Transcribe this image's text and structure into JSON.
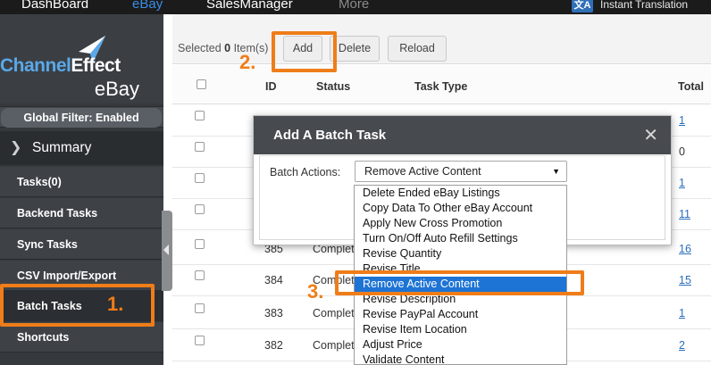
{
  "topnav": {
    "items": [
      "DashBoard",
      "eBay",
      "SalesManager",
      "More"
    ],
    "translate_label": "Instant Translation",
    "translate_icon": "translate-icon"
  },
  "sidebar": {
    "brand_left": "Channel",
    "brand_right": "Effect",
    "brand_sub": "eBay",
    "global_filter": "Global Filter: Enabled",
    "summary_label": "Summary",
    "items": [
      {
        "label": "Tasks(0)"
      },
      {
        "label": "Backend Tasks"
      },
      {
        "label": "Sync Tasks"
      },
      {
        "label": "CSV Import/Export"
      },
      {
        "label": "Batch Tasks"
      },
      {
        "label": "Shortcuts"
      }
    ]
  },
  "toolbar": {
    "selected_prefix": "Selected",
    "selected_count": "0",
    "selected_suffix": "Item(s)",
    "add_label": "Add",
    "delete_label": "Delete",
    "reload_label": "Reload"
  },
  "table": {
    "columns": [
      "ID",
      "Status",
      "Task Type",
      "Total"
    ],
    "rows": [
      {
        "id": "",
        "status": "",
        "total": "1"
      },
      {
        "id": "",
        "status": "",
        "total": "0"
      },
      {
        "id": "",
        "status": "",
        "total": "1"
      },
      {
        "id": "",
        "status": "",
        "total": "11"
      },
      {
        "id": "385",
        "status": "Complete",
        "total": "16"
      },
      {
        "id": "384",
        "status": "Complete",
        "total": "15"
      },
      {
        "id": "383",
        "status": "Complete",
        "total": "1"
      },
      {
        "id": "382",
        "status": "Complete",
        "total": "2"
      }
    ]
  },
  "modal": {
    "title": "Add A Batch Task",
    "close_icon": "close-icon",
    "batch_label": "Batch Actions:",
    "selected_value": "Remove Active Content",
    "options": [
      "Delete Ended eBay Listings",
      "Copy Data To Other eBay Account",
      "Apply New Cross Promotion",
      "Turn On/Off Auto Refill Settings",
      "Revise Quantity",
      "Revise Title",
      "Remove Active Content",
      "Revise Description",
      "Revise PayPal Account",
      "Revise Item Location",
      "Adjust Price",
      "Validate Content"
    ],
    "highlighted_index": 6
  },
  "annotations": {
    "step1": "1.",
    "step2": "2.",
    "step3": "3.",
    "color": "#ef7d18"
  },
  "colors": {
    "sidebar_bg": "#35383c",
    "topnav_bg": "#1b1b1b",
    "active_nav": "#3a8ee6",
    "highlight": "#1e74d4",
    "link": "#2a6ebb"
  }
}
